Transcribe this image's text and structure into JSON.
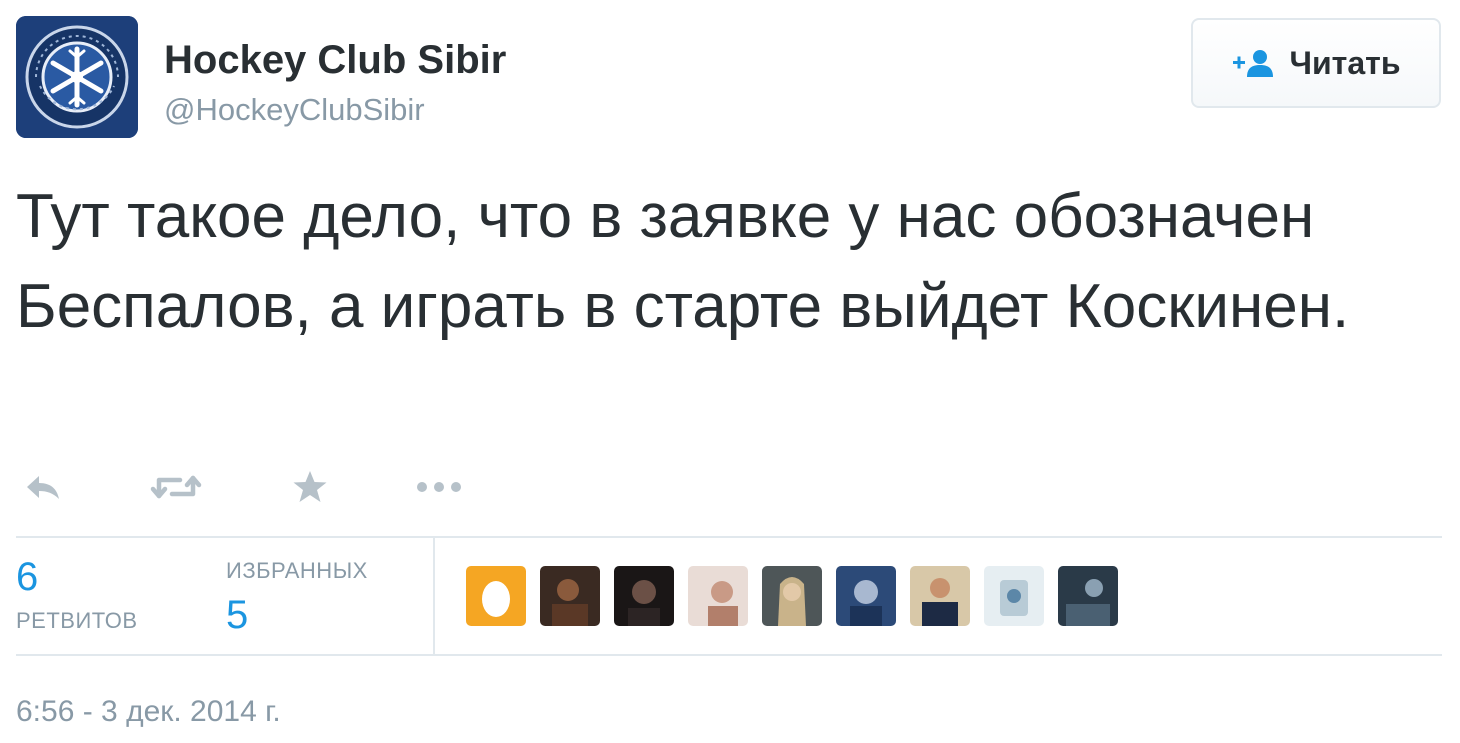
{
  "author": {
    "display_name": "Hockey Club Sibir",
    "handle": "@HockeyClubSibir",
    "avatar_icon": "snowflake-hockey-logo"
  },
  "follow_button": {
    "label": "Читать",
    "icon": "add-user-icon"
  },
  "tweet": {
    "text": "Тут такое дело, что в заявке у нас обозначен Беспалов, а играть в старте выйдет Коскинен."
  },
  "actions": {
    "reply_icon": "reply-icon",
    "retweet_icon": "retweet-icon",
    "favorite_icon": "star-icon",
    "more_icon": "more-icon"
  },
  "stats": {
    "retweets_count": "6",
    "retweets_label": "ретвитов",
    "favorites_label": "избранных",
    "favorites_count": "5"
  },
  "favorited_by_count_shown": 9,
  "timestamp": "6:56 - 3 дек. 2014 г.",
  "colors": {
    "accent": "#1b95e0",
    "muted": "#8899a6",
    "text": "#292f33",
    "border": "#e1e8ed",
    "avatar_bg": "#1d3f7a"
  }
}
